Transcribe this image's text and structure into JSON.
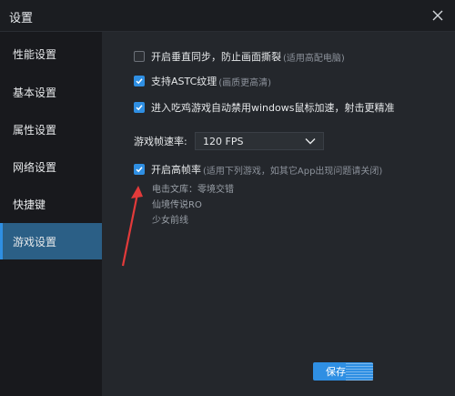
{
  "window": {
    "title": "设置",
    "close_icon": "close-icon"
  },
  "sidebar": {
    "items": [
      {
        "label": "性能设置",
        "active": false
      },
      {
        "label": "基本设置",
        "active": false
      },
      {
        "label": "属性设置",
        "active": false
      },
      {
        "label": "网络设置",
        "active": false
      },
      {
        "label": "快捷键",
        "active": false
      },
      {
        "label": "游戏设置",
        "active": true
      }
    ]
  },
  "settings": {
    "vsync": {
      "label": "开启垂直同步，防止画面撕裂",
      "hint": "(适用高配电脑)",
      "checked": false
    },
    "astc": {
      "label": "支持ASTC纹理",
      "hint": "(画质更高清)",
      "checked": true
    },
    "chicken": {
      "label": "进入吃鸡游戏自动禁用windows鼠标加速，射击更精准",
      "hint": "",
      "checked": true
    },
    "fps": {
      "label": "游戏帧速率:",
      "value": "120 FPS"
    },
    "high_fps": {
      "label": "开启高帧率",
      "hint": "(适用下列游戏，如其它App出现问题请关闭)",
      "checked": true
    },
    "games": [
      "电击文库：零境交错",
      "仙境传说RO",
      "少女前线"
    ]
  },
  "footer": {
    "save_label": "保存"
  },
  "colors": {
    "accent": "#2f8fe3",
    "sidebar_active": "#2b5f86",
    "annotation_arrow": "#e23a3a"
  }
}
